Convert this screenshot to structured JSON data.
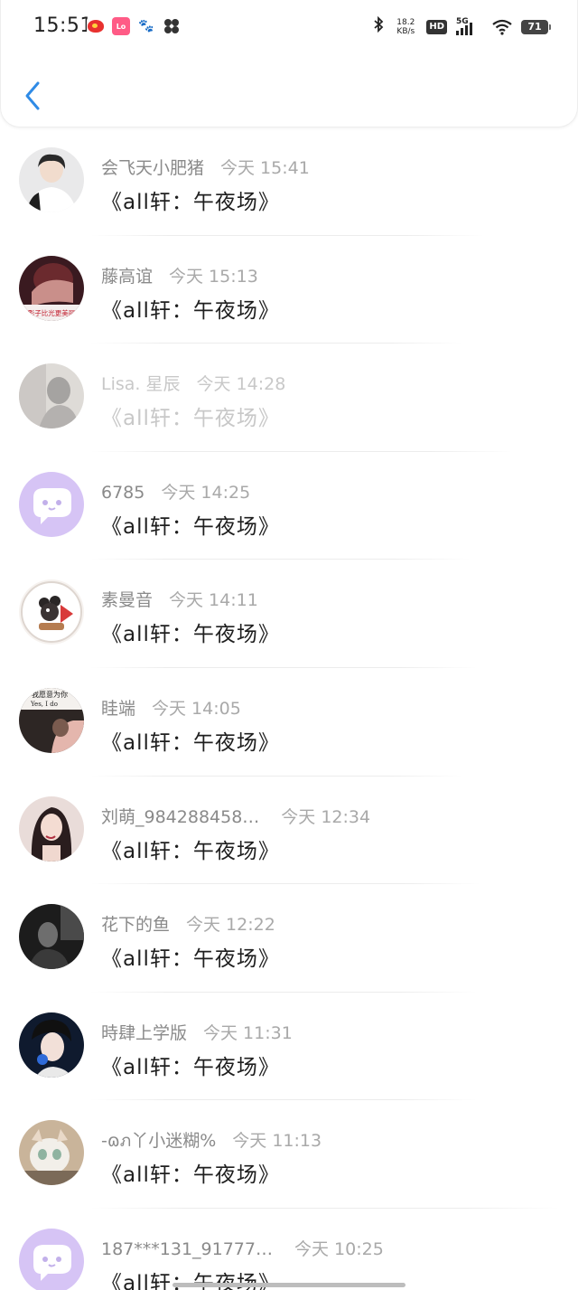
{
  "status_bar": {
    "time": "15:51",
    "network_speed_value": "18.2",
    "network_speed_unit": "KB/s",
    "hd_label": "HD",
    "signal_label": "5G",
    "battery_level": "71",
    "app_icons": [
      "weibo-icon",
      "lofter-icon",
      "baidu-icon",
      "pinwheel-icon"
    ]
  },
  "nav": {
    "back_icon": "chevron-left-icon"
  },
  "list": {
    "items": [
      {
        "name": "会飞天小肥猪",
        "time": "今天 15:41",
        "title": "《all轩：午夜场》",
        "avatar": "photo"
      },
      {
        "name": "藤高谊",
        "time": "今天 15:13",
        "title": "《all轩：午夜场》",
        "avatar": "photo"
      },
      {
        "name": "Lisa. 星辰",
        "time": "今天 14:28",
        "title": "《all轩：午夜场》",
        "avatar": "photo"
      },
      {
        "name": "6785",
        "time": "今天 14:25",
        "title": "《all轩：午夜场》",
        "avatar": "default"
      },
      {
        "name": "素曼音",
        "time": "今天 14:11",
        "title": "《all轩：午夜场》",
        "avatar": "photo"
      },
      {
        "name": "眭端",
        "time": "今天 14:05",
        "title": "《all轩：午夜场》",
        "avatar": "photo"
      },
      {
        "name": "刘萌_984288458…",
        "time": "今天 12:34",
        "title": "《all轩：午夜场》",
        "avatar": "photo"
      },
      {
        "name": "花下的鱼",
        "time": "今天 12:22",
        "title": "《all轩：午夜场》",
        "avatar": "photo"
      },
      {
        "name": "時肆上学版",
        "time": "今天 11:31",
        "title": "《all轩：午夜场》",
        "avatar": "photo"
      },
      {
        "name": "-ɷภ丫小迷糊%",
        "time": "今天 11:13",
        "title": "《all轩：午夜场》",
        "avatar": "photo"
      },
      {
        "name": "187***131_91777…",
        "time": "今天 10:25",
        "title": "《all轩：午夜场》",
        "avatar": "default"
      }
    ]
  },
  "avatar_text": {
    "row2": "影子比光更美丽",
    "row6_top": "我愿意为你",
    "row6_bottom": "Yes, I do"
  }
}
